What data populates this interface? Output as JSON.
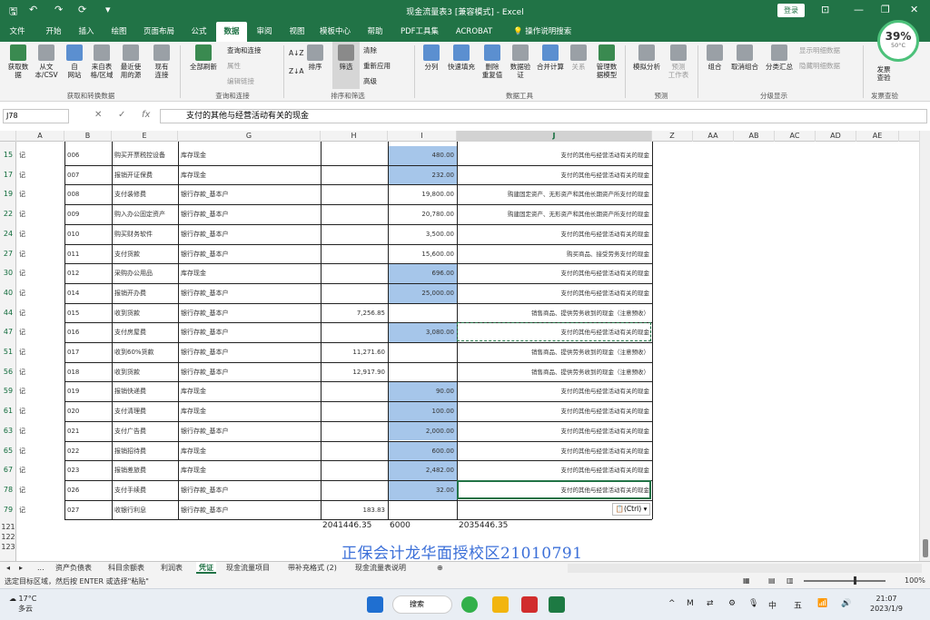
{
  "window": {
    "title": "现金流量表3 [兼容模式] - Excel",
    "login_label": "登录",
    "min_icon": "—",
    "restore_icon": "❐",
    "close_icon": "✕",
    "account_icon": "⊡"
  },
  "quick_access": [
    "🖫",
    "↶",
    "↷",
    "⟳",
    "▾"
  ],
  "tabs": [
    {
      "label": "文件"
    },
    {
      "label": "开始"
    },
    {
      "label": "插入"
    },
    {
      "label": "绘图"
    },
    {
      "label": "页面布局"
    },
    {
      "label": "公式"
    },
    {
      "label": "数据"
    },
    {
      "label": "审阅"
    },
    {
      "label": "视图"
    },
    {
      "label": "模板中心"
    },
    {
      "label": "帮助"
    },
    {
      "label": "PDF工具集"
    },
    {
      "label": "ACROBAT"
    }
  ],
  "tell_me": "💡 操作说明搜索",
  "perf_widget": {
    "percent": "39%",
    "temp": "50°C"
  },
  "ribbon": {
    "get_data": {
      "label": "获取数\n据",
      "group": "获取和转换数据"
    },
    "from_text": {
      "label": "从文\n本/CSV"
    },
    "from_web": {
      "label": "自\n网站"
    },
    "from_table": {
      "label": "来自表\n格/区域"
    },
    "recent": {
      "label": "最近使\n用的源"
    },
    "existing": {
      "label": "现有\n连接"
    },
    "refresh_all": {
      "label": "全部刷新",
      "group": "查询和连接"
    },
    "queries": "查询和连接",
    "props": "属性",
    "edit_links": "编辑链接",
    "sort_az": "A↓Z",
    "sort_za": "Z↓A",
    "sort": {
      "label": "排序"
    },
    "filter": {
      "label": "筛选",
      "group": "排序和筛选"
    },
    "clear": "清除",
    "reapply": "重新应用",
    "advanced": "高级",
    "split": {
      "label": "分列"
    },
    "flash_fill": {
      "label": "快速填充"
    },
    "remove_dup": {
      "label": "删除\n重复值"
    },
    "validate": {
      "label": "数据验\n证"
    },
    "consolidate": {
      "label": "合并计算"
    },
    "relations": {
      "label": "关系"
    },
    "data_model": {
      "label": "管理数\n据模型",
      "group": "数据工具"
    },
    "what_if": {
      "label": "模拟分析"
    },
    "forecast": {
      "label": "预测\n工作表",
      "group": "预测"
    },
    "group_btn": {
      "label": "组合"
    },
    "ungroup": {
      "label": "取消组合"
    },
    "subtotal": {
      "label": "分类汇总",
      "group": "分级显示"
    },
    "show_detail": "显示明细数据",
    "hide_detail": "隐藏明细数据",
    "invoice": {
      "label": "发票\n查验",
      "group": "发票查验"
    }
  },
  "formula_bar": {
    "name_box": "J78",
    "cancel_icon": "✕",
    "enter_icon": "✓",
    "fx_icon": "fx",
    "content": "支付的其他与经营活动有关的现金"
  },
  "columns": [
    "A",
    "B",
    "E",
    "G",
    "H",
    "I",
    "J",
    "Z",
    "AA",
    "AB",
    "AC",
    "AD",
    "AE"
  ],
  "rows": [
    {
      "row": "15",
      "a": "记",
      "b": "006",
      "e": "购买开票税控设备",
      "g": "库存现金",
      "h": "",
      "i": "480.00",
      "ihl": true,
      "j": "支付的其他与经营活动有关的现金"
    },
    {
      "row": "17",
      "a": "记",
      "b": "007",
      "e": "报销开证保费",
      "g": "库存现金",
      "h": "",
      "i": "232.00",
      "ihl": true,
      "j": "支付的其他与经营活动有关的现金"
    },
    {
      "row": "19",
      "a": "记",
      "b": "008",
      "e": "支付装修费",
      "g": "银行存款_基本户",
      "h": "",
      "i": "19,800.00",
      "ihl": false,
      "j": "购建固定资产、无形资产和其他长期资产所支付的现金"
    },
    {
      "row": "22",
      "a": "记",
      "b": "009",
      "e": "购入办公固定资产",
      "g": "银行存款_基本户",
      "h": "",
      "i": "20,780.00",
      "ihl": false,
      "j": "购建固定资产、无形资产和其他长期资产所支付的现金"
    },
    {
      "row": "24",
      "a": "记",
      "b": "010",
      "e": "购买财务软件",
      "g": "银行存款_基本户",
      "h": "",
      "i": "3,500.00",
      "ihl": false,
      "j": "支付的其他与经营活动有关的现金"
    },
    {
      "row": "27",
      "a": "记",
      "b": "011",
      "e": "支付货款",
      "g": "银行存款_基本户",
      "h": "",
      "i": "15,600.00",
      "ihl": false,
      "j": "购买商品、接受劳务支付的现金"
    },
    {
      "row": "30",
      "a": "记",
      "b": "012",
      "e": "采购办公用品",
      "g": "库存现金",
      "h": "",
      "i": "696.00",
      "ihl": true,
      "j": "支付的其他与经营活动有关的现金"
    },
    {
      "row": "40",
      "a": "记",
      "b": "014",
      "e": "报销开办费",
      "g": "银行存款_基本户",
      "h": "",
      "i": "25,000.00",
      "ihl": true,
      "j": "支付的其他与经营活动有关的现金"
    },
    {
      "row": "44",
      "a": "记",
      "b": "015",
      "e": "收到货款",
      "g": "银行存款_基本户",
      "h": "7,256.85",
      "i": "",
      "ihl": false,
      "j": "销售商品、提供劳务收到的现金（注意预收）"
    },
    {
      "row": "47",
      "a": "记",
      "b": "016",
      "e": "支付房屋费",
      "g": "银行存款_基本户",
      "h": "",
      "i": "3,080.00",
      "ihl": true,
      "j": "支付的其他与经营活动有关的现金"
    },
    {
      "row": "51",
      "a": "记",
      "b": "017",
      "e": "收到60%货款",
      "g": "银行存款_基本户",
      "h": "11,271.60",
      "i": "",
      "ihl": false,
      "j": "销售商品、提供劳务收到的现金（注意预收）"
    },
    {
      "row": "56",
      "a": "记",
      "b": "018",
      "e": "收到货款",
      "g": "银行存款_基本户",
      "h": "12,917.90",
      "i": "",
      "ihl": false,
      "j": "销售商品、提供劳务收到的现金（注意预收）"
    },
    {
      "row": "59",
      "a": "记",
      "b": "019",
      "e": "报销快递费",
      "g": "库存现金",
      "h": "",
      "i": "90.00",
      "ihl": true,
      "j": "支付的其他与经营活动有关的现金"
    },
    {
      "row": "61",
      "a": "记",
      "b": "020",
      "e": "支付清理费",
      "g": "库存现金",
      "h": "",
      "i": "100.00",
      "ihl": true,
      "j": "支付的其他与经营活动有关的现金"
    },
    {
      "row": "63",
      "a": "记",
      "b": "021",
      "e": "支付广告费",
      "g": "银行存款_基本户",
      "h": "",
      "i": "2,000.00",
      "ihl": true,
      "j": "支付的其他与经营活动有关的现金"
    },
    {
      "row": "65",
      "a": "记",
      "b": "022",
      "e": "报销招待费",
      "g": "库存现金",
      "h": "",
      "i": "600.00",
      "ihl": true,
      "j": "支付的其他与经营活动有关的现金"
    },
    {
      "row": "67",
      "a": "记",
      "b": "023",
      "e": "报销差旅费",
      "g": "库存现金",
      "h": "",
      "i": "2,482.00",
      "ihl": true,
      "j": "支付的其他与经营活动有关的现金"
    },
    {
      "row": "78",
      "a": "记",
      "b": "026",
      "e": "支付手续费",
      "g": "银行存款_基本户",
      "h": "",
      "i": "32.00",
      "ihl": true,
      "j": "支付的其他与经营活动有关的现金"
    },
    {
      "row": "79",
      "a": "记",
      "b": "027",
      "e": "收银行利息",
      "g": "银行存款_基本户",
      "h": "183.83",
      "i": "",
      "ihl": false,
      "j": ""
    }
  ],
  "extra_rows": [
    "121",
    "122",
    "123"
  ],
  "totals": {
    "h": "2041446.35",
    "i": "6000",
    "j": "2035446.35"
  },
  "paste_options": "📋(Ctrl) ▾",
  "watermark": "正保会计龙华面授校区21010791",
  "sheet_tabs": [
    {
      "label": "..."
    },
    {
      "label": "资产负债表"
    },
    {
      "label": "科目余额表"
    },
    {
      "label": "利润表"
    },
    {
      "label": "凭证",
      "active": true
    },
    {
      "label": "现金流量项目"
    },
    {
      "label": "带补充格式 (2)"
    },
    {
      "label": "现金流量表说明"
    }
  ],
  "add_sheet": "⊕",
  "status": {
    "message": "选定目标区域，然后按 ENTER 或选择\"粘贴\"",
    "zoom": "100%"
  },
  "taskbar": {
    "weather_temp": "17°C",
    "weather_desc": "多云",
    "search_label": "搜索",
    "tray_items": [
      "^",
      "M",
      "⇄",
      "⚙",
      "🎙",
      "中",
      "五",
      "📶",
      "🔊"
    ],
    "time": "21:07",
    "date": "2023/1/9"
  }
}
